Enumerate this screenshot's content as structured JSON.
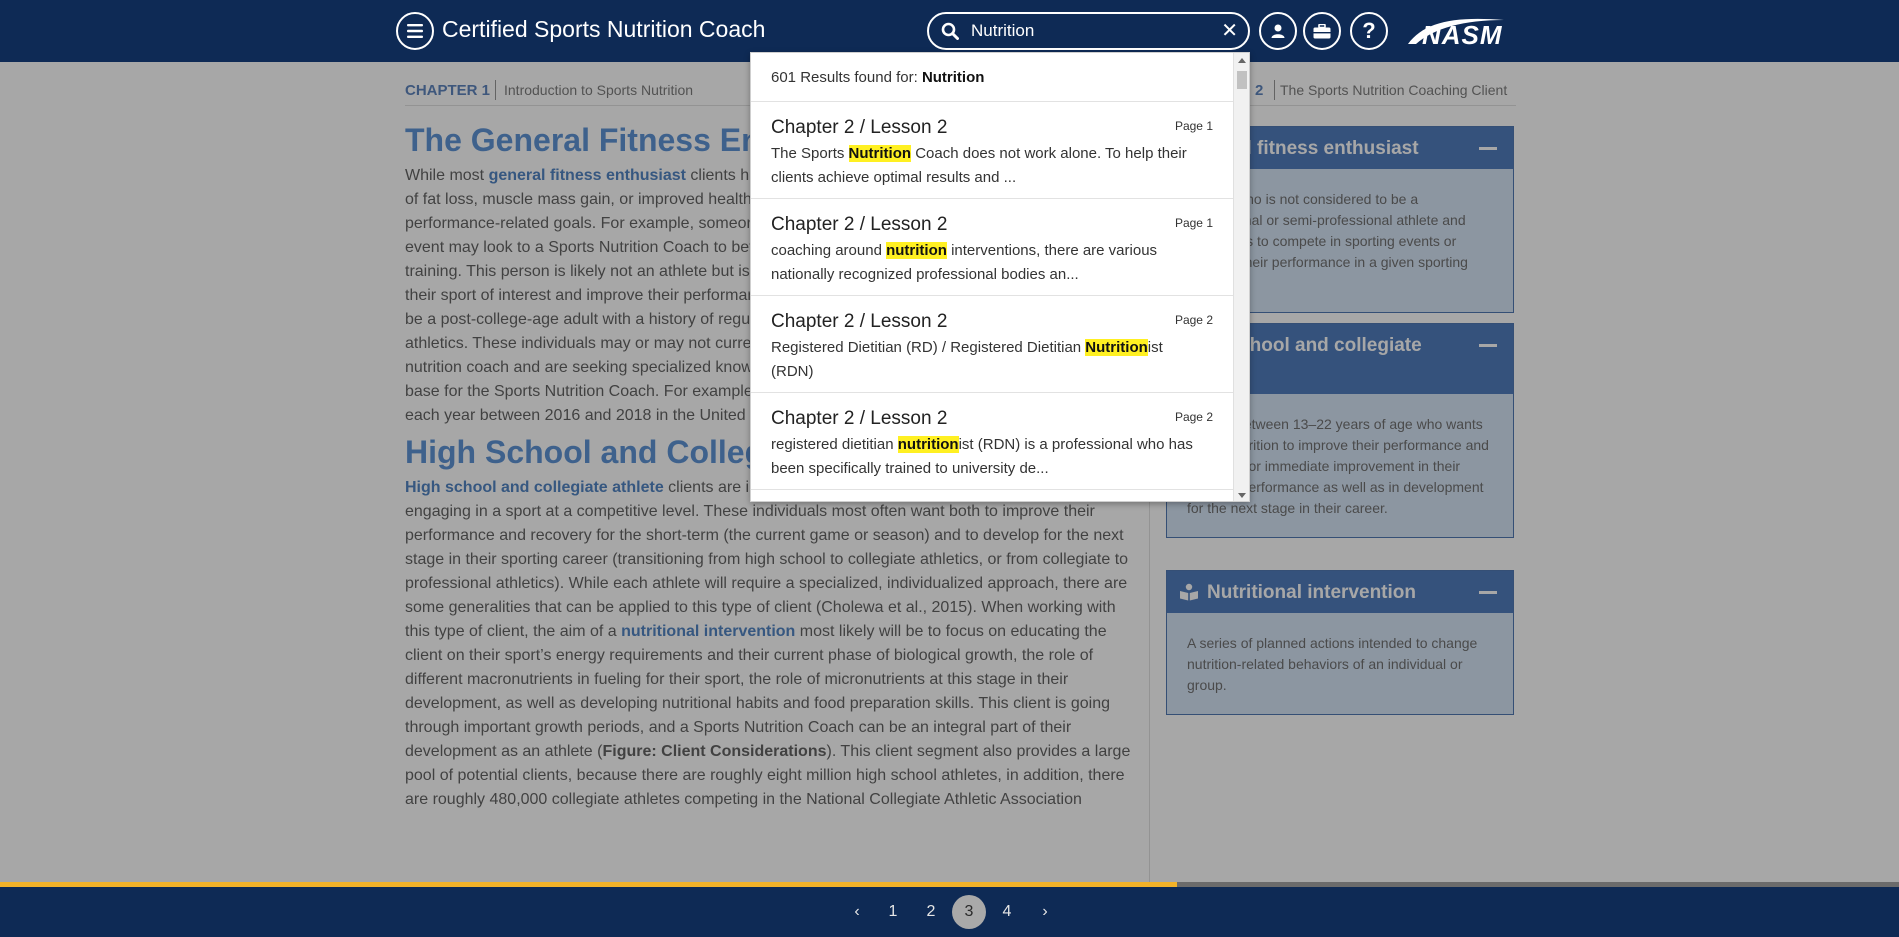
{
  "header": {
    "title": "Certified Sports Nutrition Coach",
    "search_value": "Nutrition",
    "logo_text": "NASM"
  },
  "chapter": {
    "label": "CHAPTER 1",
    "name": "Introduction to Sports Nutrition",
    "right_number": "2",
    "right_name": "The Sports Nutrition Coaching Client"
  },
  "article": {
    "heading1": "The General Fitness Enthusiast",
    "para1": {
      "pre": "While most ",
      "term": "general fitness enthusiast",
      "post": " clients hire a personal trainer to help them to reach their goals of fat loss, muscle mass gain, or improved health, some seek out a Sports Nutrition Coach for various performance-related goals. For example, someone who wants to complete their first endurance sporting event may look to a Sports Nutrition Coach to better understand how to use nutrition to support their training. This person is likely not an athlete but is someone who wants to compete in or participate in their sport of interest and improve their performance in a given competition or event. This individual may be a post-college-age adult with a history of regularly exercising and maybe even a history of youth athletics. These individuals may or may not currently work with a fitness professional or general nutrition coach and are seeking specialized knowledge. These clients represent an important client base for the Sports Nutrition Coach. For example, roughly four million people competed in road races each year between 2016 and 2018 in the United States."
    },
    "heading2": "High School and Collegiate Athletes",
    "para2": {
      "term1": "High school and collegiate athlete",
      "text1": " clients are individuals between the ages of 13–22 and are engaging in a sport at a competitive level. These individuals most often want both to improve their performance and recovery for the short-term (the current game or season) and to develop for the next stage in their sporting career (transitioning from high school to collegiate athletics, or from collegiate to professional athletics). While each athlete will require a specialized, individualized approach, there are some generalities that can be applied to this type of client (Cholewa et al., 2015). When working with this type of client, the aim of a ",
      "term2": "nutritional intervention",
      "text2": " most likely will be to focus on educating the client on their sport’s energy requirements and their current phase of biological growth, the role of different macronutrients in fueling for their sport, the role of micronutrients at this stage in their development, as well as developing nutritional habits and food preparation skills. This client is going through important growth periods, and a Sports Nutrition Coach can be an integral part of their development as an athlete (",
      "figure": "Figure: Client Considerations",
      "text3": "). This client segment also provides a large pool of potential clients, because there are roughly eight million high school athletes, in addition, there are roughly 480,000 collegiate athletes competing in the National Collegiate Athletic Association"
    }
  },
  "sidebar": {
    "cards": [
      {
        "title": "General fitness enthusiast",
        "body": "A client who is not considered to be a professional or semi-professional athlete and who wants to compete in sporting events or improve their performance in a given sporting event."
      },
      {
        "title": "High school and collegiate athlete",
        "body": "A client between 13–22 years of age who wants to use nutrition to improve their performance and recovery for immediate improvement in their sporting performance as well as in development for the next stage in their career."
      },
      {
        "title": "Nutritional intervention",
        "body": "A series of planned actions intended to change nutrition-related behaviors of an individual or group."
      }
    ]
  },
  "search_results": {
    "count_text": "601 Results found for: ",
    "query": "Nutrition",
    "items": [
      {
        "title": "Chapter 2 / Lesson 2",
        "page": "Page 1",
        "pre": "The Sports ",
        "match": "Nutrition",
        "post": " Coach does not work alone. To help their clients achieve optimal results and ..."
      },
      {
        "title": "Chapter 2 / Lesson 2",
        "page": "Page 1",
        "pre": "coaching around ",
        "match": "nutrition",
        "post": " interventions, there are various nationally recognized professional bodies an..."
      },
      {
        "title": "Chapter 2 / Lesson 2",
        "page": "Page 2",
        "pre": "Registered Dietitian (RD) / Registered Dietitian ",
        "match": "Nutrition",
        "post": "ist (RDN)"
      },
      {
        "title": "Chapter 2 / Lesson 2",
        "page": "Page 2",
        "pre": "registered dietitian ",
        "match": "nutrition",
        "post": "ist (RDN) is a professional who has been specifically trained to university de..."
      }
    ]
  },
  "pagination": {
    "pages": [
      "1",
      "2",
      "3",
      "4"
    ],
    "current": "3",
    "prev": "‹",
    "next": "›",
    "progress": 0.62
  },
  "colors": {
    "header_bg": "#0e2a55",
    "accent_blue": "#2c73c9",
    "highlight": "#fff022",
    "progress": "#f2b229"
  }
}
